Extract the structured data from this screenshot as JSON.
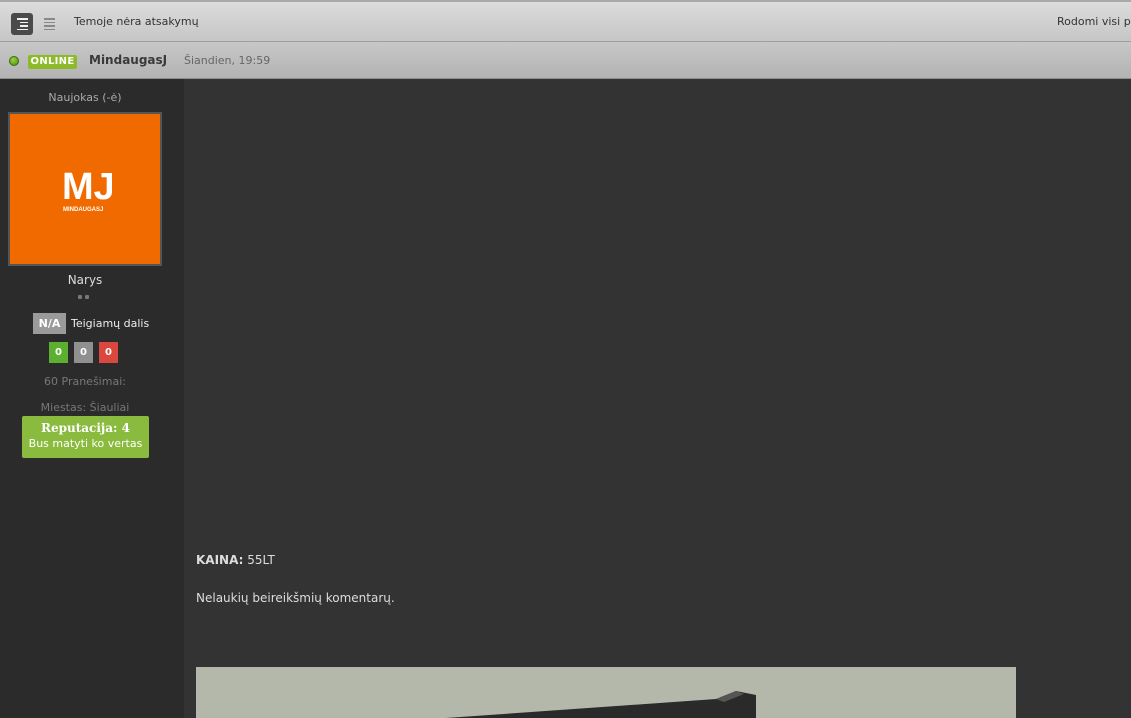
{
  "toolbar": {
    "view_threaded_icon": "threaded-view-icon",
    "view_linear_icon": "linear-view-icon",
    "no_replies_text": "Temoje nėra atsakymų",
    "showing_all_text": "Rodomi visi pranešimai"
  },
  "post": {
    "online_badge": "ONLINE",
    "author": "MindaugasJ",
    "date": "Šiandien, 19:59",
    "price_label": "KAINA:",
    "price_value": "55LT",
    "note": "Nelaukių beireikšmių komentarų."
  },
  "profile": {
    "rank_title": "Naujokas (-ė)",
    "avatar_text": "MJ",
    "avatar_subtext": "MINDAUGASJ",
    "avatar_color": "#f06a00",
    "group": "Narys",
    "positive_value": "N/A",
    "positive_label": "Teigiamų dalis",
    "votes": {
      "positive": "0",
      "neutral": "0",
      "negative": "0"
    },
    "post_count": "60 Pranešimai:",
    "city": "Miestas: Šiauliai",
    "reputation_title": "Reputacija: 4",
    "reputation_sub": "Bus matyti ko vertas"
  },
  "colors": {
    "online_green": "#8cba2b",
    "reputation_green": "#8bbb3e",
    "vote_positive": "#5cb030",
    "vote_negative": "#d9473f"
  }
}
